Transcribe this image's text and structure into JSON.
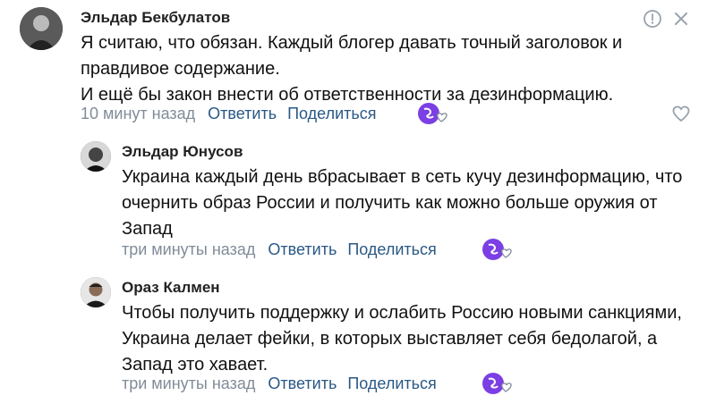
{
  "comments": [
    {
      "author": "Эльдар Бекбулатов",
      "lines": [
        "Я считаю, что обязан. Каждый блогер давать точный заголовок и",
        "правдивое содержание.",
        "И ещё бы закон внести об ответственности за дезинформацию."
      ],
      "time": "10 минут назад",
      "reply": "Ответить",
      "share": "Поделиться"
    },
    {
      "author": "Эльдар Юнусов",
      "lines": [
        "Украина каждый день вбрасывает в сеть кучу дезинформацию, что",
        "очернить образ России и получить как можно больше оружия от",
        "Запад"
      ],
      "time": "три минуты назад",
      "reply": "Ответить",
      "share": "Поделиться"
    },
    {
      "author": "Ораз Калмен",
      "lines": [
        "Чтобы получить поддержку и ослабить Россию новыми санкциями,",
        "Украина делает фейки, в которых выставляет себя бедолагой, а",
        "Запад это хавает."
      ],
      "time": "три минуты назад",
      "reply": "Ответить",
      "share": "Поделиться"
    }
  ],
  "icons": {
    "report": "exclamation-circle-icon",
    "close": "close-icon",
    "like": "heart-icon",
    "reaction": "reaction-icon"
  },
  "colors": {
    "link": "#2a5885",
    "meta": "#818c99",
    "reaction": "#7b3fe4"
  }
}
